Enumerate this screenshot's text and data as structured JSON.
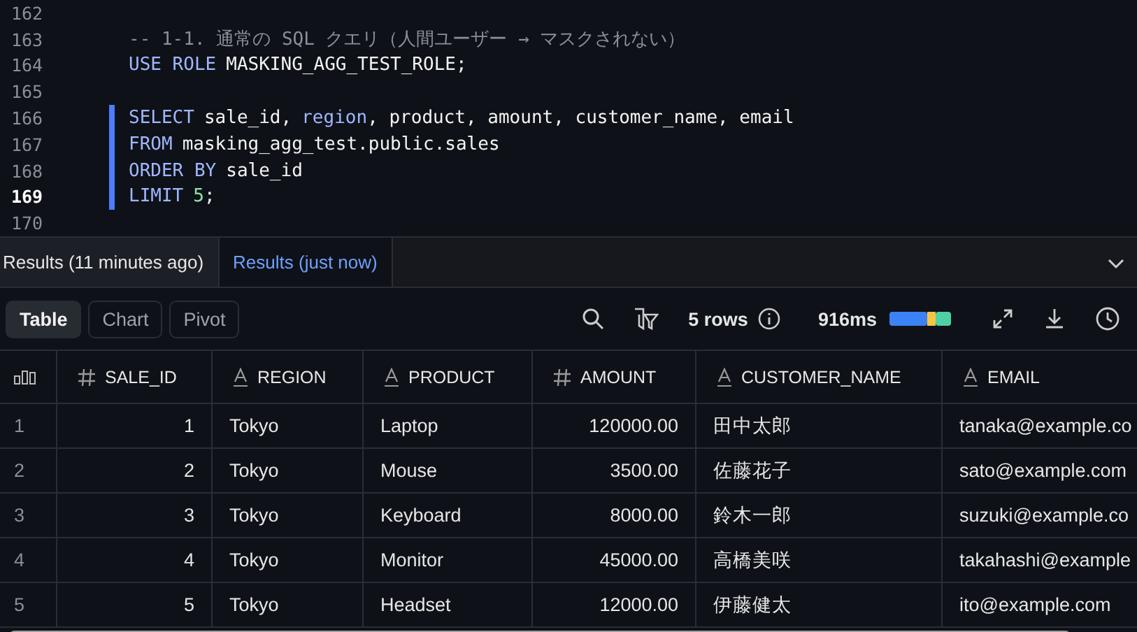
{
  "editor": {
    "lines": [
      {
        "number": "162",
        "current": false,
        "changed": false
      },
      {
        "number": "163",
        "current": false,
        "changed": false,
        "tokens": [
          {
            "kind": "comment",
            "text": "-- 1-1. 通常の SQL クエリ（人間ユーザー → マスクされない）"
          }
        ]
      },
      {
        "number": "164",
        "current": false,
        "changed": false,
        "tokens": [
          {
            "kind": "keyword",
            "text": "USE ROLE"
          },
          {
            "kind": "plain",
            "text": "MASKING_AGG_TEST_ROLE;"
          }
        ]
      },
      {
        "number": "165",
        "current": false,
        "changed": false
      },
      {
        "number": "166",
        "current": false,
        "changed": true,
        "tokens": [
          {
            "kind": "keyword",
            "text": "SELECT"
          },
          {
            "kind": "plain",
            "text": "sale_id,"
          },
          {
            "kind": "keyword",
            "text": "region"
          },
          {
            "kind": "plain",
            "text": ", product, amount, customer_name, email",
            "attached": true
          }
        ]
      },
      {
        "number": "167",
        "current": false,
        "changed": true,
        "tokens": [
          {
            "kind": "keyword",
            "text": "FROM"
          },
          {
            "kind": "plain",
            "text": "masking_agg_test.public.sales"
          }
        ]
      },
      {
        "number": "168",
        "current": false,
        "changed": true,
        "tokens": [
          {
            "kind": "keyword",
            "text": "ORDER BY"
          },
          {
            "kind": "plain",
            "text": "sale_id"
          }
        ]
      },
      {
        "number": "169",
        "current": true,
        "changed": true,
        "tokens": [
          {
            "kind": "keyword",
            "text": "LIMIT"
          },
          {
            "kind": "number",
            "text": "5"
          },
          {
            "kind": "plain",
            "text": ";",
            "attached": true
          }
        ]
      },
      {
        "number": "170",
        "current": false,
        "changed": false
      }
    ]
  },
  "result_tabs": [
    {
      "label": "Results (11 minutes ago)",
      "selected": false
    },
    {
      "label": "Results (just now)",
      "selected": true
    }
  ],
  "view_tabs": [
    {
      "label": "Table",
      "selected": true
    },
    {
      "label": "Chart",
      "selected": false
    },
    {
      "label": "Pivot",
      "selected": false
    }
  ],
  "row_count": "5 rows",
  "duration": "916ms",
  "table": {
    "columns": [
      {
        "name": "SALE_ID",
        "kind": "number"
      },
      {
        "name": "REGION",
        "kind": "text"
      },
      {
        "name": "PRODUCT",
        "kind": "text"
      },
      {
        "name": "AMOUNT",
        "kind": "number"
      },
      {
        "name": "CUSTOMER_NAME",
        "kind": "text"
      },
      {
        "name": "EMAIL",
        "kind": "text"
      }
    ],
    "rows": [
      {
        "index": "1",
        "cells": [
          "1",
          "Tokyo",
          "Laptop",
          "120000.00",
          "田中太郎",
          "tanaka@example.co"
        ]
      },
      {
        "index": "2",
        "cells": [
          "2",
          "Tokyo",
          "Mouse",
          "3500.00",
          "佐藤花子",
          "sato@example.com"
        ]
      },
      {
        "index": "3",
        "cells": [
          "3",
          "Tokyo",
          "Keyboard",
          "8000.00",
          "鈴木一郎",
          "suzuki@example.co"
        ]
      },
      {
        "index": "4",
        "cells": [
          "4",
          "Tokyo",
          "Monitor",
          "45000.00",
          "高橋美咲",
          "takahashi@example"
        ]
      },
      {
        "index": "5",
        "cells": [
          "5",
          "Tokyo",
          "Headset",
          "12000.00",
          "伊藤健太",
          "ito@example.com"
        ]
      }
    ]
  }
}
